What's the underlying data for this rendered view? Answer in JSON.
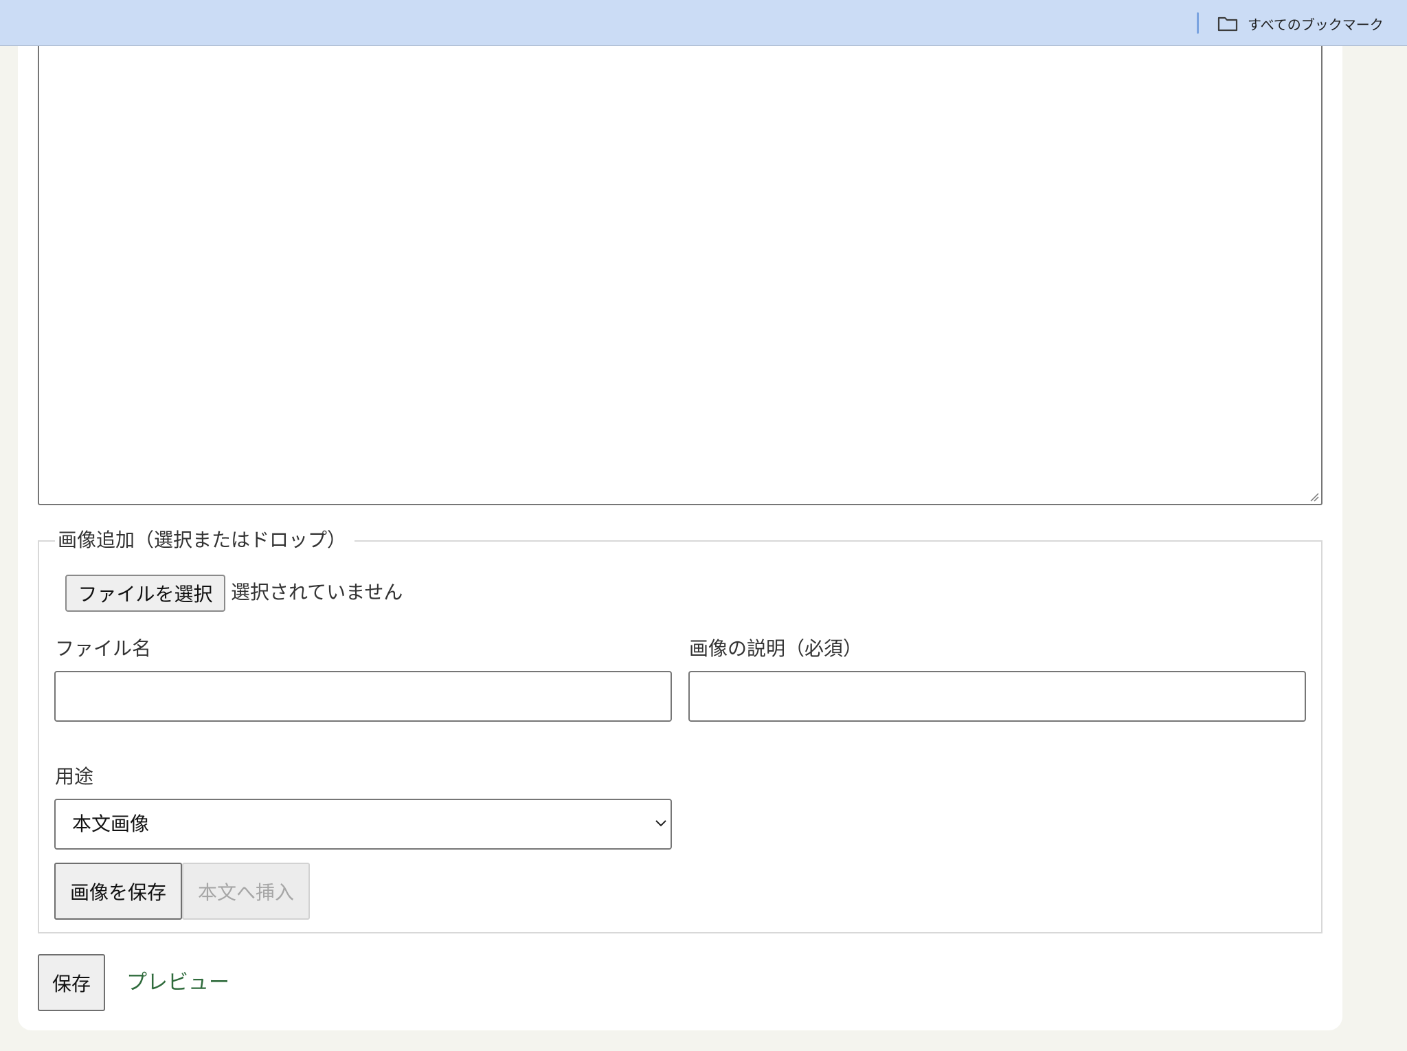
{
  "bookmarks_bar": {
    "all_bookmarks_label": "すべてのブックマーク",
    "folder_icon": "folder-icon"
  },
  "image_upload": {
    "legend": "画像追加（選択またはドロップ）",
    "file_button_label": "ファイルを選択",
    "file_status": "選択されていません",
    "filename_label": "ファイル名",
    "filename_value": "",
    "description_label": "画像の説明（必須）",
    "description_value": "",
    "purpose_label": "用途",
    "purpose_selected": "本文画像",
    "save_image_label": "画像を保存",
    "insert_label": "本文へ挿入"
  },
  "form": {
    "save_label": "保存",
    "preview_label": "プレビュー"
  },
  "colors": {
    "bookmarks_bar": "#cbdcf5",
    "page_background": "#f4f4ee",
    "link_green": "#2f6b3c"
  }
}
